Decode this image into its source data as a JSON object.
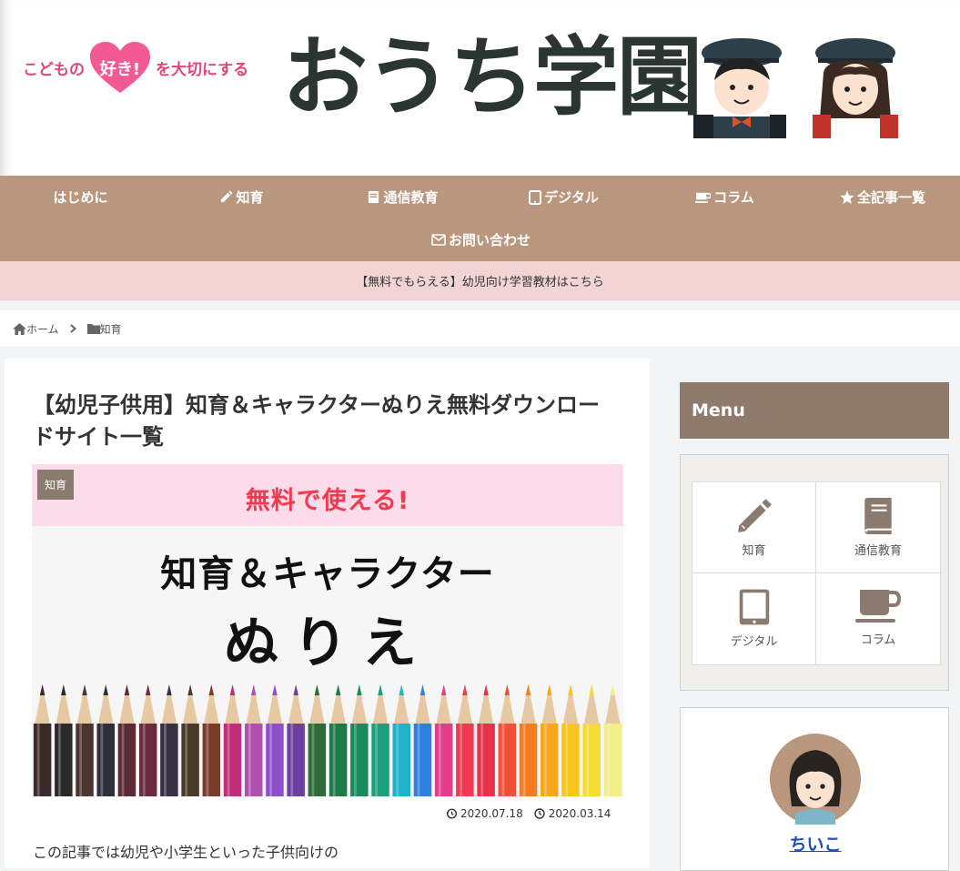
{
  "header": {
    "tagline_before": "こどもの",
    "tagline_heart": "好き!",
    "tagline_after": "を大切にする",
    "site_title": "おうち学園"
  },
  "nav": {
    "items": [
      {
        "label": "はじめに",
        "icon": "none"
      },
      {
        "label": "知育",
        "icon": "pencil-icon"
      },
      {
        "label": "通信教育",
        "icon": "book-icon"
      },
      {
        "label": "デジタル",
        "icon": "tablet-icon"
      },
      {
        "label": "コラム",
        "icon": "cup-icon"
      },
      {
        "label": "全記事一覧",
        "icon": "star-icon"
      },
      {
        "label": "お問い合わせ",
        "icon": "mail-icon"
      }
    ]
  },
  "notice": {
    "text": "【無料でもらえる】幼児向け学習教材はこちら"
  },
  "breadcrumb": {
    "home": "ホーム",
    "category": "知育"
  },
  "article": {
    "title": "【幼児子供用】知育＆キャラクターぬりえ無料ダウンロードサイト一覧",
    "eyecatch": {
      "category_label": "知育",
      "banner_text": "無料で使える!",
      "headline1": "知育＆キャラクター",
      "headline2": "ぬりえ"
    },
    "updated_date": "2020.07.18",
    "published_date": "2020.03.14",
    "intro": "この記事では幼児や小学生といった子供向けの"
  },
  "sidebar": {
    "menu_title": "Menu",
    "menu_items": [
      {
        "label": "知育",
        "icon": "pencil-icon"
      },
      {
        "label": "通信教育",
        "icon": "book-icon"
      },
      {
        "label": "デジタル",
        "icon": "tablet-icon"
      },
      {
        "label": "コラム",
        "icon": "cup-icon"
      }
    ],
    "profile_name": "ちいこ"
  },
  "colors": {
    "nav_bg": "#b9977e",
    "notice_bg": "#f2d4d5",
    "menu_head_bg": "#8f7a6c",
    "icon_brown": "#8b7a70",
    "tagline_pink": "#e0457b",
    "banner_red": "#ef3a4f",
    "profile_link": "#1a4fbf"
  }
}
